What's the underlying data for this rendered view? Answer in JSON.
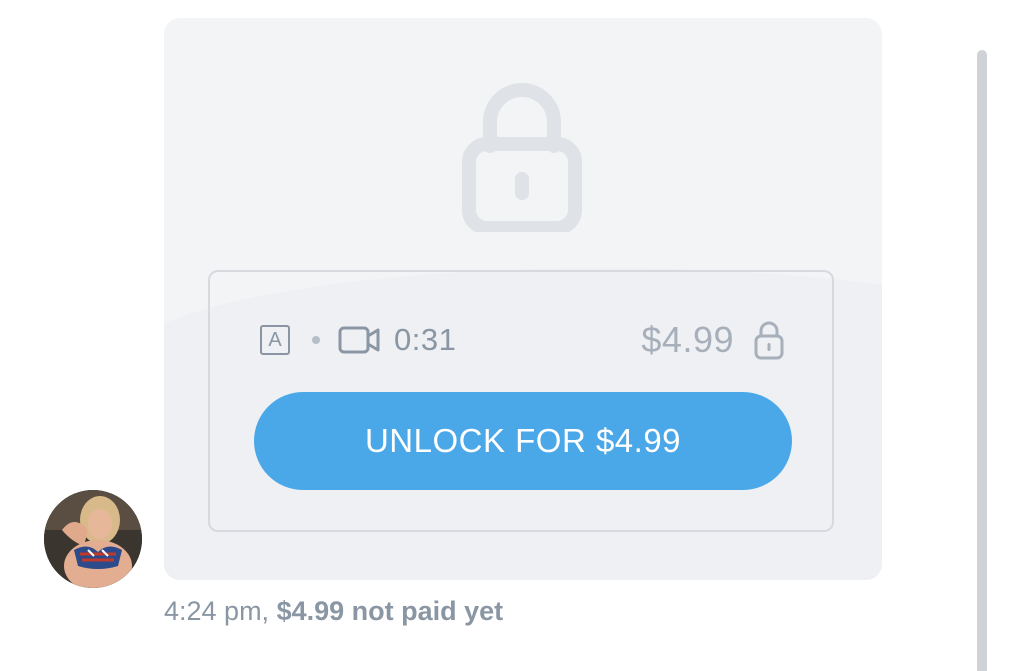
{
  "message": {
    "media": {
      "duration": "0:31",
      "price": "$4.99",
      "unlock_label": "UNLOCK FOR $4.99",
      "content_badge": "A",
      "icons": {
        "big_lock": "lock-icon",
        "badge": "text-badge-icon",
        "video": "video-camera-icon",
        "price_lock": "lock-icon"
      }
    },
    "time": "4:24 pm,",
    "payment_status": "$4.99 not paid yet"
  },
  "colors": {
    "accent": "#4aa8e8",
    "card_bg": "#f3f4f6",
    "muted_text": "#8a96a3",
    "lock_icon": "#dfe2e6"
  }
}
